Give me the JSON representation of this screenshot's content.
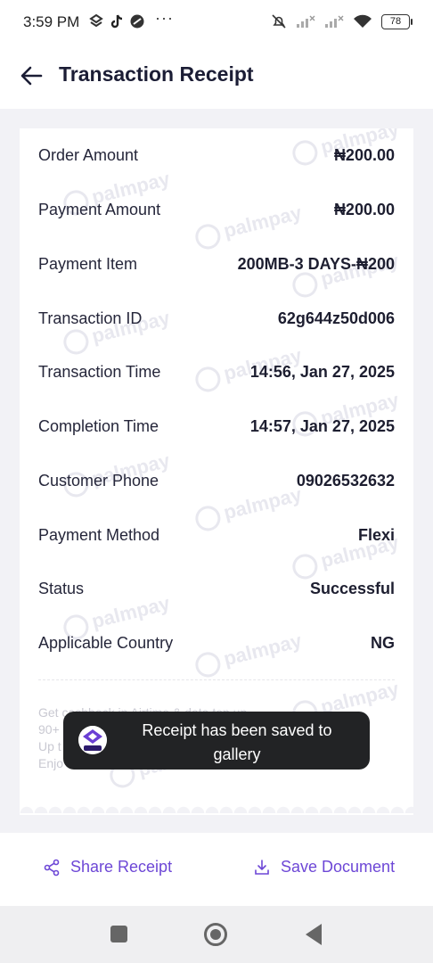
{
  "status_bar": {
    "time": "3:59 PM",
    "more": "···",
    "battery": "78"
  },
  "header": {
    "title": "Transaction Receipt"
  },
  "receipt": {
    "watermark": "palmpay",
    "rows": [
      {
        "label": "Order Amount",
        "value": "₦200.00"
      },
      {
        "label": "Payment Amount",
        "value": "₦200.00"
      },
      {
        "label": "Payment Item",
        "value": "200MB-3 DAYS-₦200"
      },
      {
        "label": "Transaction ID",
        "value": "62g644z50d006"
      },
      {
        "label": "Transaction Time",
        "value": "14:56, Jan 27, 2025"
      },
      {
        "label": "Completion Time",
        "value": "14:57, Jan 27, 2025"
      },
      {
        "label": "Customer Phone",
        "value": "09026532632"
      },
      {
        "label": "Payment Method",
        "value": "Flexi"
      },
      {
        "label": "Status",
        "value": "Successful"
      },
      {
        "label": "Applicable Country",
        "value": "NG"
      }
    ],
    "promo_lines": [
      "Get cashback in Airtime & data top up",
      "90+",
      "Up t",
      "Enjo"
    ]
  },
  "toast": {
    "message": "Receipt has been saved to gallery"
  },
  "actions": {
    "share_label": "Share Receipt",
    "save_label": "Save Document"
  },
  "colors": {
    "accent": "#6d47d6",
    "background": "#f2f2f6",
    "toast_bg": "#222325"
  },
  "icons": {
    "back": "arrow-left-icon",
    "share": "share-icon",
    "save": "download-icon"
  }
}
